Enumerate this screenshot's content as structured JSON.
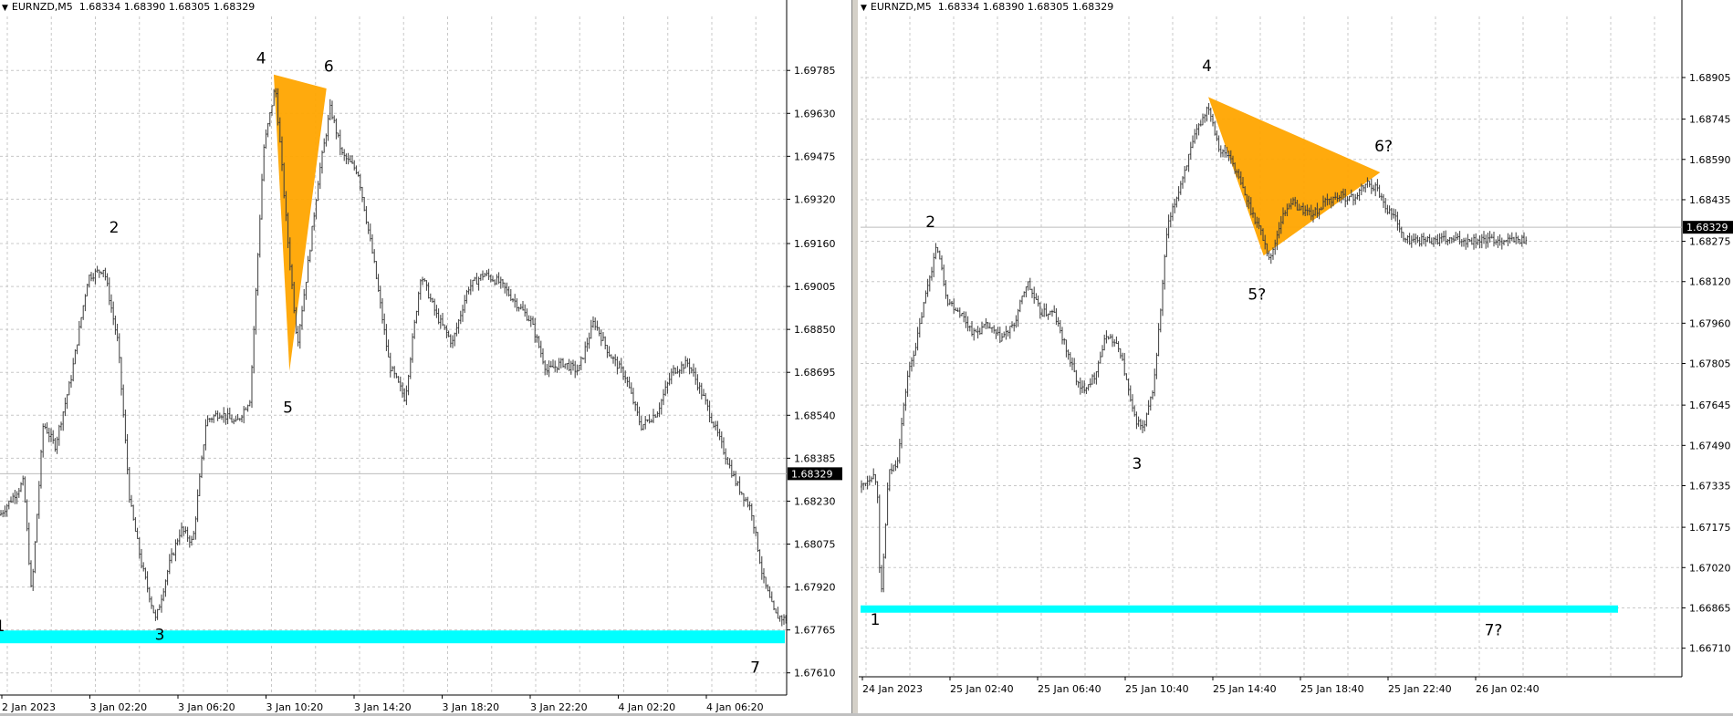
{
  "colors": {
    "candle": "#3c3c3c",
    "grid": "#c8c8c8",
    "support_line": "#00ffff",
    "pattern_fill": "#ffa500",
    "price_tag_bg": "#000000",
    "price_tag_text": "#ffffff"
  },
  "charts": [
    {
      "header": {
        "symbol": "EURNZD,M5",
        "ohlc": "1.68334 1.68390 1.68305 1.68329"
      },
      "current_price": "1.68329",
      "icons": [
        "dropdown-arrow-icon"
      ]
    },
    {
      "header": {
        "symbol": "EURNZD,M5",
        "ohlc": "1.68334 1.68390 1.68305 1.68329"
      },
      "current_price": "1.68329",
      "icons": [
        "dropdown-arrow-icon"
      ]
    }
  ],
  "chart_data": [
    {
      "type": "candlestick",
      "symbol": "EURNZD",
      "timeframe": "M5",
      "y_ticks": [
        "1.69785",
        "1.69630",
        "1.69475",
        "1.69320",
        "1.69160",
        "1.69005",
        "1.68850",
        "1.68695",
        "1.68540",
        "1.68385",
        "1.68230",
        "1.68075",
        "1.67920",
        "1.67765",
        "1.67610"
      ],
      "x_ticks": [
        "2 Jan 2023",
        "3 Jan 02:20",
        "3 Jan 06:20",
        "3 Jan 10:20",
        "3 Jan 14:20",
        "3 Jan 18:20",
        "3 Jan 22:20",
        "4 Jan 02:20",
        "4 Jan 06:20"
      ],
      "ylim": [
        1.6753,
        1.6998
      ],
      "x_index_range": [
        0,
        1000
      ],
      "current_price": 1.68329,
      "support_level": 1.6774,
      "price_path": [
        [
          0,
          1.6818
        ],
        [
          30,
          1.683
        ],
        [
          40,
          1.6789
        ],
        [
          55,
          1.6851
        ],
        [
          70,
          1.6843
        ],
        [
          90,
          1.6867
        ],
        [
          112,
          1.6904
        ],
        [
          132,
          1.6907
        ],
        [
          150,
          1.688
        ],
        [
          165,
          1.6823
        ],
        [
          180,
          1.68
        ],
        [
          198,
          1.678
        ],
        [
          215,
          1.68
        ],
        [
          230,
          1.6813
        ],
        [
          245,
          1.6808
        ],
        [
          262,
          1.6852
        ],
        [
          280,
          1.6855
        ],
        [
          300,
          1.6851
        ],
        [
          318,
          1.686
        ],
        [
          335,
          1.695
        ],
        [
          350,
          1.6973
        ],
        [
          365,
          1.692
        ],
        [
          378,
          1.688
        ],
        [
          390,
          1.6905
        ],
        [
          405,
          1.694
        ],
        [
          420,
          1.6965
        ],
        [
          435,
          1.6948
        ],
        [
          455,
          1.6942
        ],
        [
          475,
          1.691
        ],
        [
          495,
          1.6872
        ],
        [
          515,
          1.686
        ],
        [
          535,
          1.6905
        ],
        [
          555,
          1.689
        ],
        [
          575,
          1.688
        ],
        [
          595,
          1.69
        ],
        [
          615,
          1.6905
        ],
        [
          635,
          1.6902
        ],
        [
          655,
          1.6895
        ],
        [
          675,
          1.6888
        ],
        [
          695,
          1.687
        ],
        [
          715,
          1.6873
        ],
        [
          735,
          1.687
        ],
        [
          755,
          1.6888
        ],
        [
          775,
          1.6876
        ],
        [
          795,
          1.6868
        ],
        [
          815,
          1.685
        ],
        [
          835,
          1.6855
        ],
        [
          855,
          1.687
        ],
        [
          875,
          1.6873
        ],
        [
          895,
          1.686
        ],
        [
          915,
          1.6845
        ],
        [
          935,
          1.683
        ],
        [
          955,
          1.682
        ],
        [
          970,
          1.6795
        ],
        [
          985,
          1.6782
        ],
        [
          1000,
          1.678
        ]
      ],
      "wave_labels": [
        {
          "label": "1",
          "x": 0,
          "y": 1.6776
        },
        {
          "label": "2",
          "x": 145,
          "y": 1.692
        },
        {
          "label": "3",
          "x": 203,
          "y": 1.6773
        },
        {
          "label": "4",
          "x": 332,
          "y": 1.6981
        },
        {
          "label": "5",
          "x": 366,
          "y": 1.6855
        },
        {
          "label": "6",
          "x": 418,
          "y": 1.6978
        },
        {
          "label": "7",
          "x": 960,
          "y": 1.6761
        }
      ],
      "pattern_triangle": [
        [
          348,
          1.6977
        ],
        [
          368,
          1.687
        ],
        [
          415,
          1.6972
        ]
      ]
    },
    {
      "type": "candlestick",
      "symbol": "EURNZD",
      "timeframe": "M5",
      "y_ticks": [
        "1.68905",
        "1.68745",
        "1.68590",
        "1.68435",
        "1.68275",
        "1.68120",
        "1.67960",
        "1.67805",
        "1.67645",
        "1.67490",
        "1.67335",
        "1.67175",
        "1.67020",
        "1.66865",
        "1.66710"
      ],
      "x_ticks": [
        "24 Jan 2023",
        "25 Jan 02:40",
        "25 Jan 06:40",
        "25 Jan 10:40",
        "25 Jan 14:40",
        "25 Jan 18:40",
        "25 Jan 22:40",
        "26 Jan 02:40"
      ],
      "ylim": [
        1.666,
        1.6914
      ],
      "x_index_range": [
        0,
        1000
      ],
      "current_price": 1.68329,
      "support_level": 1.6685,
      "price_path": [
        [
          0,
          1.6733
        ],
        [
          18,
          1.6738
        ],
        [
          25,
          1.6735
        ],
        [
          30,
          1.6686
        ],
        [
          42,
          1.6738
        ],
        [
          55,
          1.6743
        ],
        [
          70,
          1.6775
        ],
        [
          85,
          1.679
        ],
        [
          100,
          1.681
        ],
        [
          115,
          1.6826
        ],
        [
          130,
          1.6805
        ],
        [
          150,
          1.68
        ],
        [
          170,
          1.6792
        ],
        [
          190,
          1.6795
        ],
        [
          210,
          1.679
        ],
        [
          230,
          1.6795
        ],
        [
          250,
          1.6812
        ],
        [
          270,
          1.68
        ],
        [
          290,
          1.68
        ],
        [
          310,
          1.6785
        ],
        [
          330,
          1.677
        ],
        [
          350,
          1.6775
        ],
        [
          370,
          1.6792
        ],
        [
          390,
          1.6785
        ],
        [
          410,
          1.676
        ],
        [
          425,
          1.6755
        ],
        [
          440,
          1.6772
        ],
        [
          450,
          1.68
        ],
        [
          460,
          1.6832
        ],
        [
          475,
          1.6845
        ],
        [
          490,
          1.6858
        ],
        [
          505,
          1.687
        ],
        [
          522,
          1.688
        ],
        [
          540,
          1.6862
        ],
        [
          555,
          1.686
        ],
        [
          570,
          1.685
        ],
        [
          585,
          1.684
        ],
        [
          600,
          1.6832
        ],
        [
          615,
          1.682
        ],
        [
          630,
          1.6835
        ],
        [
          645,
          1.6843
        ],
        [
          660,
          1.684
        ],
        [
          680,
          1.6838
        ],
        [
          700,
          1.6843
        ],
        [
          720,
          1.6845
        ],
        [
          740,
          1.6844
        ],
        [
          760,
          1.685
        ],
        [
          775,
          1.6848
        ],
        [
          790,
          1.684
        ],
        [
          805,
          1.6836
        ],
        [
          815,
          1.6828
        ]
      ],
      "wave_labels": [
        {
          "label": "1",
          "x": 22,
          "y": 1.668
        },
        {
          "label": "2",
          "x": 105,
          "y": 1.6833
        },
        {
          "label": "3",
          "x": 415,
          "y": 1.674
        },
        {
          "label": "4",
          "x": 520,
          "y": 1.6893
        },
        {
          "label": "5?",
          "x": 595,
          "y": 1.6805
        },
        {
          "label": "6?",
          "x": 785,
          "y": 1.6862
        },
        {
          "label": "7?",
          "x": 950,
          "y": 1.6676
        }
      ],
      "pattern_triangle": [
        [
          522,
          1.6883
        ],
        [
          605,
          1.6822
        ],
        [
          780,
          1.6854
        ]
      ]
    }
  ]
}
